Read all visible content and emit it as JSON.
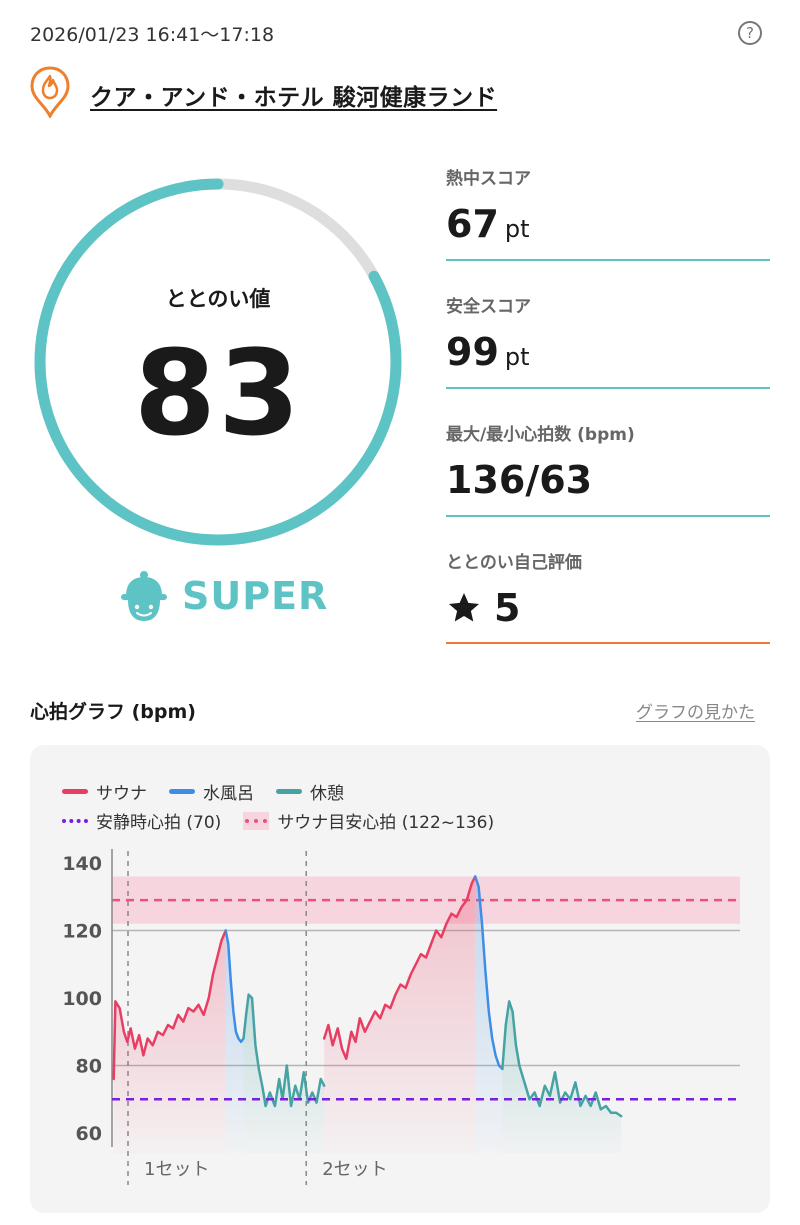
{
  "header": {
    "datetime": "2026/01/23 16:41〜17:18",
    "help_icon": "help-circle-icon",
    "help_glyph": "?",
    "facility_icon": "sauna-flame-pin-icon",
    "facility_name": "クア・アンド・ホテル 駿河健康ランド"
  },
  "totonoi": {
    "label": "ととのい値",
    "value": "83",
    "gauge_fraction": 0.83,
    "rank_icon": "sauna-hat-face-icon",
    "rank": "SUPER"
  },
  "metrics": [
    {
      "label": "熱中スコア",
      "value": "67",
      "unit": "pt"
    },
    {
      "label": "安全スコア",
      "value": "99",
      "unit": "pt"
    },
    {
      "label": "最大/最小心拍数 (bpm)",
      "value": "136/63",
      "unit": ""
    },
    {
      "label": "ととのい自己評価",
      "value": "5",
      "unit": "",
      "icon": "star-icon"
    }
  ],
  "graph": {
    "title": "心拍グラフ (bpm)",
    "guide_link": "グラフの見かた",
    "legend": {
      "sauna": "サウナ",
      "water": "水風呂",
      "rest": "休憩",
      "resting_hr": "安静時心拍 (70)",
      "sauna_target": "サウナ目安心拍 (122~136)"
    },
    "set_labels": [
      "1セット",
      "2セット"
    ]
  },
  "colors": {
    "accent": "#5ec3c5",
    "gauge_track": "#dedede",
    "sauna": "#e83e63",
    "water": "#3f8ee6",
    "rest": "#47a3a3",
    "resting_hr": "#7a1fe0",
    "target_band": "#f7d5de",
    "target_line": "#e8537c",
    "rating_underline": "#e87a3a",
    "flame_icon": "#ee7f2d"
  },
  "chart_data": {
    "type": "line",
    "ylabel": "bpm",
    "ylim": [
      60,
      140
    ],
    "yticks": [
      60,
      80,
      100,
      120,
      140
    ],
    "x_unit": "minutes",
    "xlim": [
      0,
      37
    ],
    "grid": "horizontal at 80 and 120",
    "resting_hr": 70,
    "target_band": [
      122,
      136
    ],
    "target_line": 129,
    "set_markers": [
      {
        "label": "1セット",
        "x": 0
      },
      {
        "label": "2セット",
        "x": 10.5
      }
    ],
    "series": [
      {
        "name": "サウナ",
        "color": "#e83e63",
        "points": [
          [
            0.1,
            76
          ],
          [
            0.2,
            99
          ],
          [
            0.45,
            97
          ],
          [
            0.7,
            90
          ],
          [
            0.9,
            87
          ],
          [
            1.1,
            91
          ],
          [
            1.35,
            85
          ],
          [
            1.6,
            89
          ],
          [
            1.85,
            83
          ],
          [
            2.1,
            88
          ],
          [
            2.4,
            86
          ],
          [
            2.7,
            90
          ],
          [
            3.0,
            89
          ],
          [
            3.3,
            92
          ],
          [
            3.6,
            91
          ],
          [
            3.9,
            95
          ],
          [
            4.2,
            93
          ],
          [
            4.5,
            97
          ],
          [
            4.8,
            96
          ],
          [
            5.1,
            98
          ],
          [
            5.4,
            95
          ],
          [
            5.7,
            100
          ],
          [
            5.95,
            107
          ],
          [
            6.2,
            112
          ],
          [
            6.45,
            117
          ],
          [
            6.7,
            120
          ]
        ]
      },
      {
        "name": "水風呂",
        "color": "#3f8ee6",
        "points": [
          [
            6.7,
            120
          ],
          [
            6.85,
            116
          ],
          [
            7.0,
            105
          ],
          [
            7.15,
            96
          ],
          [
            7.3,
            90
          ],
          [
            7.45,
            88
          ],
          [
            7.6,
            87
          ],
          [
            7.75,
            88
          ]
        ]
      },
      {
        "name": "休憩",
        "color": "#47a3a3",
        "points": [
          [
            7.75,
            88
          ],
          [
            7.9,
            95
          ],
          [
            8.05,
            101
          ],
          [
            8.25,
            100
          ],
          [
            8.45,
            86
          ],
          [
            8.65,
            79
          ],
          [
            8.85,
            74
          ],
          [
            9.05,
            68
          ],
          [
            9.3,
            72
          ],
          [
            9.6,
            68
          ],
          [
            9.85,
            76
          ],
          [
            10.05,
            70
          ],
          [
            10.3,
            80
          ],
          [
            10.55,
            68
          ],
          [
            10.8,
            74
          ],
          [
            11.05,
            70
          ],
          [
            11.3,
            78
          ],
          [
            11.55,
            69
          ],
          [
            11.8,
            72
          ],
          [
            12.05,
            69
          ],
          [
            12.3,
            76
          ],
          [
            12.5,
            74
          ]
        ]
      },
      {
        "name": "サウナ",
        "color": "#e83e63",
        "points": [
          [
            12.5,
            88
          ],
          [
            12.75,
            92
          ],
          [
            13.0,
            86
          ],
          [
            13.3,
            91
          ],
          [
            13.55,
            85
          ],
          [
            13.8,
            82
          ],
          [
            14.1,
            90
          ],
          [
            14.35,
            87
          ],
          [
            14.6,
            94
          ],
          [
            14.9,
            90
          ],
          [
            15.2,
            93
          ],
          [
            15.5,
            96
          ],
          [
            15.8,
            94
          ],
          [
            16.1,
            98
          ],
          [
            16.4,
            97
          ],
          [
            16.7,
            101
          ],
          [
            17.0,
            104
          ],
          [
            17.3,
            103
          ],
          [
            17.6,
            107
          ],
          [
            17.9,
            110
          ],
          [
            18.2,
            113
          ],
          [
            18.5,
            112
          ],
          [
            18.8,
            116
          ],
          [
            19.1,
            120
          ],
          [
            19.4,
            118
          ],
          [
            19.7,
            122
          ],
          [
            20.0,
            125
          ],
          [
            20.3,
            124
          ],
          [
            20.6,
            127
          ],
          [
            20.9,
            129
          ],
          [
            21.2,
            134
          ],
          [
            21.4,
            136
          ]
        ]
      },
      {
        "name": "水風呂",
        "color": "#3f8ee6",
        "points": [
          [
            21.4,
            136
          ],
          [
            21.6,
            133
          ],
          [
            21.8,
            122
          ],
          [
            22.0,
            108
          ],
          [
            22.2,
            96
          ],
          [
            22.4,
            88
          ],
          [
            22.6,
            83
          ],
          [
            22.8,
            80
          ],
          [
            23.0,
            79
          ]
        ]
      },
      {
        "name": "休憩",
        "color": "#47a3a3",
        "points": [
          [
            23.0,
            79
          ],
          [
            23.2,
            92
          ],
          [
            23.4,
            99
          ],
          [
            23.6,
            96
          ],
          [
            23.8,
            86
          ],
          [
            24.0,
            80
          ],
          [
            24.3,
            75
          ],
          [
            24.6,
            70
          ],
          [
            24.9,
            72
          ],
          [
            25.2,
            68
          ],
          [
            25.5,
            74
          ],
          [
            25.8,
            71
          ],
          [
            26.1,
            78
          ],
          [
            26.4,
            69
          ],
          [
            26.7,
            72
          ],
          [
            27.0,
            70
          ],
          [
            27.3,
            75
          ],
          [
            27.6,
            68
          ],
          [
            27.9,
            71
          ],
          [
            28.2,
            68
          ],
          [
            28.5,
            72
          ],
          [
            28.8,
            67
          ],
          [
            29.1,
            68
          ],
          [
            29.4,
            66
          ],
          [
            29.7,
            66
          ],
          [
            30.0,
            65
          ]
        ]
      }
    ]
  }
}
